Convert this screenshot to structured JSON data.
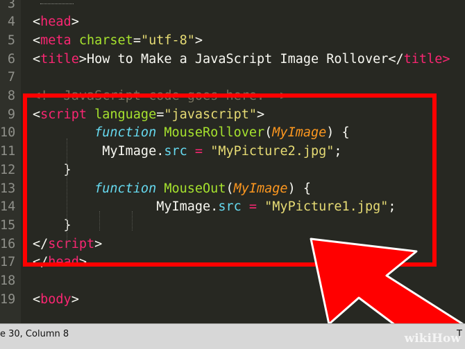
{
  "editor": {
    "lines": [
      {
        "num": "3",
        "segments": []
      },
      {
        "num": "4",
        "segments": [
          {
            "t": "<",
            "c": "plain"
          },
          {
            "t": "head",
            "c": "tag"
          },
          {
            "t": ">",
            "c": "plain"
          }
        ]
      },
      {
        "num": "5",
        "segments": [
          {
            "t": "<",
            "c": "plain"
          },
          {
            "t": "meta",
            "c": "tag"
          },
          {
            "t": " ",
            "c": "plain"
          },
          {
            "t": "charset",
            "c": "attr"
          },
          {
            "t": "=",
            "c": "plain"
          },
          {
            "t": "\"utf-8\"",
            "c": "str"
          },
          {
            "t": ">",
            "c": "plain"
          }
        ]
      },
      {
        "num": "6",
        "segments": [
          {
            "t": "<",
            "c": "plain"
          },
          {
            "t": "title",
            "c": "tag"
          },
          {
            "t": ">How to Make a JavaScript Image Rollover</",
            "c": "plain"
          },
          {
            "t": "title>",
            "c": "tag"
          }
        ]
      },
      {
        "num": "7",
        "segments": []
      },
      {
        "num": "8",
        "segments": [
          {
            "t": "<!--JavaScript code goes here.-->",
            "c": "comment"
          }
        ]
      },
      {
        "num": "9",
        "segments": [
          {
            "t": "<",
            "c": "plain"
          },
          {
            "t": "script",
            "c": "tag"
          },
          {
            "t": " ",
            "c": "plain"
          },
          {
            "t": "language",
            "c": "attr"
          },
          {
            "t": "=",
            "c": "plain"
          },
          {
            "t": "\"javascript\"",
            "c": "str"
          },
          {
            "t": ">",
            "c": "plain"
          }
        ]
      },
      {
        "num": "10",
        "segments": [
          {
            "t": "        ",
            "c": "plain"
          },
          {
            "t": "function",
            "c": "kw"
          },
          {
            "t": " ",
            "c": "plain"
          },
          {
            "t": "MouseRollover",
            "c": "fn"
          },
          {
            "t": "(",
            "c": "plain"
          },
          {
            "t": "MyImage",
            "c": "param"
          },
          {
            "t": ") {",
            "c": "plain"
          }
        ]
      },
      {
        "num": "11",
        "segments": [
          {
            "t": "         MyImage.",
            "c": "plain"
          },
          {
            "t": "src",
            "c": "prop"
          },
          {
            "t": " ",
            "c": "plain"
          },
          {
            "t": "=",
            "c": "op"
          },
          {
            "t": " ",
            "c": "plain"
          },
          {
            "t": "\"MyPicture2.jpg\"",
            "c": "str"
          },
          {
            "t": ";",
            "c": "plain"
          }
        ]
      },
      {
        "num": "12",
        "segments": [
          {
            "t": "    }",
            "c": "plain"
          }
        ]
      },
      {
        "num": "13",
        "segments": [
          {
            "t": "        ",
            "c": "plain"
          },
          {
            "t": "function",
            "c": "kw"
          },
          {
            "t": " ",
            "c": "plain"
          },
          {
            "t": "MouseOut",
            "c": "fn"
          },
          {
            "t": "(",
            "c": "plain"
          },
          {
            "t": "MyImage",
            "c": "param"
          },
          {
            "t": ") {",
            "c": "plain"
          }
        ]
      },
      {
        "num": "14",
        "segments": [
          {
            "t": "                MyImage.",
            "c": "plain"
          },
          {
            "t": "src",
            "c": "prop"
          },
          {
            "t": " ",
            "c": "plain"
          },
          {
            "t": "=",
            "c": "op"
          },
          {
            "t": " ",
            "c": "plain"
          },
          {
            "t": "\"MyPicture1.jpg\"",
            "c": "str"
          },
          {
            "t": ";",
            "c": "plain"
          }
        ]
      },
      {
        "num": "15",
        "segments": [
          {
            "t": "    }",
            "c": "plain"
          }
        ]
      },
      {
        "num": "16",
        "segments": [
          {
            "t": "</",
            "c": "plain"
          },
          {
            "t": "script",
            "c": "tag"
          },
          {
            "t": ">",
            "c": "plain"
          }
        ]
      },
      {
        "num": "17",
        "segments": [
          {
            "t": "</",
            "c": "plain"
          },
          {
            "t": "head",
            "c": "tag"
          },
          {
            "t": ">",
            "c": "plain"
          }
        ]
      },
      {
        "num": "18",
        "segments": []
      },
      {
        "num": "19",
        "segments": [
          {
            "t": "<",
            "c": "plain"
          },
          {
            "t": "body",
            "c": "tag"
          },
          {
            "t": ">",
            "c": "plain"
          }
        ]
      }
    ]
  },
  "statusbar": {
    "position_text": "e 30, Column 8",
    "right_text": "T"
  },
  "watermark": "wikiHow",
  "colors": {
    "background": "#272822",
    "highlight": "#ff0000",
    "tag": "#f92672",
    "attribute": "#a6e22e",
    "string": "#e6db74",
    "keyword": "#66d9ef",
    "parameter": "#fd971f",
    "comment": "#75715e"
  },
  "icons": {
    "annotation": "red-arrow-icon"
  }
}
